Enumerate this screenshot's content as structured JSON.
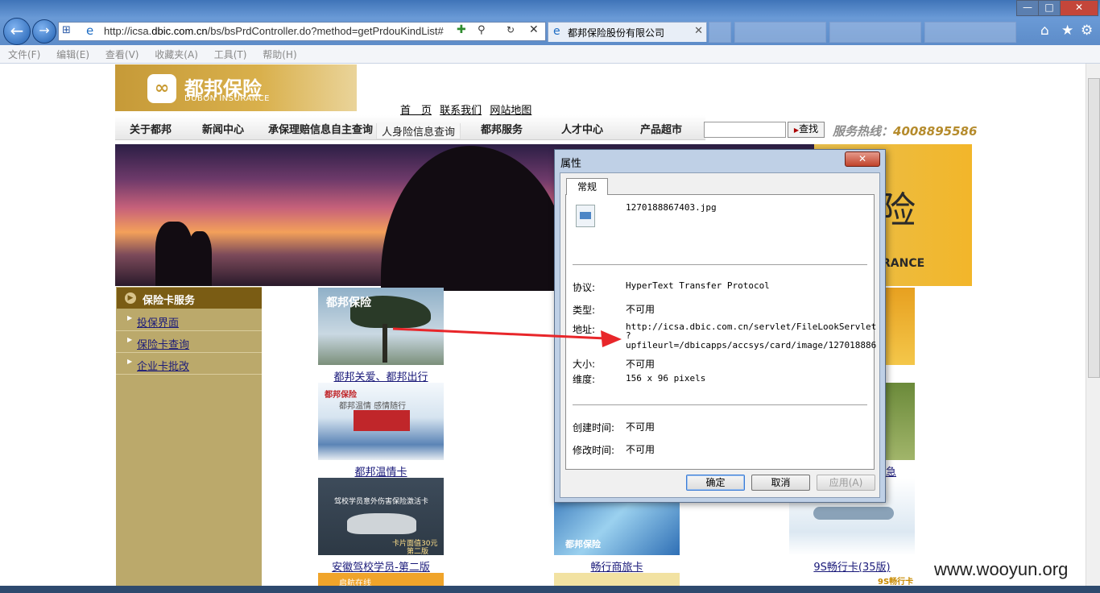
{
  "browser": {
    "url_prefix": "http://icsa.",
    "url_host": "dbic.com.cn",
    "url_rest": "/bs/bsPrdController.do?method=getPrdouKindList#",
    "tab_title": "都邦保险股份有限公司",
    "menu": [
      "文件(F)",
      "编辑(E)",
      "查看(V)",
      "收藏夹(A)",
      "工具(T)",
      "帮助(H)"
    ]
  },
  "site": {
    "logo_cn": "都邦保险",
    "logo_en": "DUBON INSURANCE",
    "top_links": [
      "首　页",
      "联系我们",
      "网站地图"
    ],
    "nav": [
      "关于都邦",
      "新闻中心",
      "承保理赔信息自主查询",
      "人身险信息查询",
      "都邦服务",
      "人才中心",
      "产品超市"
    ],
    "search_button": "查找",
    "hotline_label": "服务热线：",
    "hotline_number": "4008895586",
    "banner_right_en": "RANCE"
  },
  "sidebar": {
    "header": "保险卡服务",
    "items": [
      "投保界面",
      "保险卡查询",
      "企业卡批改"
    ]
  },
  "cards": {
    "c1": "都邦关爱、都邦出行",
    "c2": "都邦温情卡",
    "c3": "安徽驾校学员-第二版",
    "c4": "畅行商旅卡",
    "c5": "9S畅行卡(35版)",
    "c_right2": "急",
    "c1_logo": "都邦保险",
    "c2_logo": "都邦保险",
    "c2_slogan": "都邦温情  感情随行",
    "c3_line": "驾校学员意外伤害保险激活卡",
    "c3_price": "卡片面值30元",
    "c3_ed": "第二版",
    "c4_logo": "都邦保险",
    "bot1_label": "启航在线",
    "c5_footer": "9S畅行卡"
  },
  "dialog": {
    "title": "属性",
    "tab": "常规",
    "filename": "1270188867403.jpg",
    "protocol_label": "协议:",
    "protocol": "HyperText Transfer Protocol",
    "type_label": "类型:",
    "type": "不可用",
    "address_label": "地址:",
    "address_l1": "http://icsa.dbic.com.cn/servlet/FileLookServlet",
    "address_l2": "?",
    "address_l3": "upfileurl=/dbicapps/accsys/card/image/127018886",
    "size_label": "大小:",
    "size": "不可用",
    "dim_label": "维度:",
    "dims": "156  x  96  pixels",
    "created_label": "创建时间:",
    "created": "不可用",
    "modified_label": "修改时间:",
    "modified": "不可用",
    "ok": "确定",
    "cancel": "取消",
    "apply": "应用(A)"
  },
  "watermark": "www.wooyun.org",
  "colors": {
    "brand_gold": "#c69a38",
    "arrow_red": "#e8262a",
    "sidebar_brown": "#7a5c14"
  }
}
